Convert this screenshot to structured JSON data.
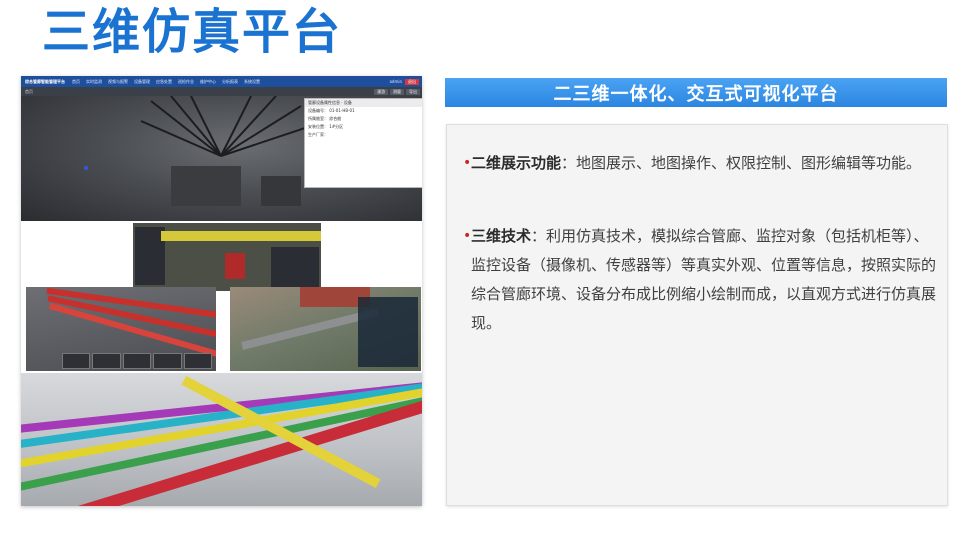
{
  "slide": {
    "title": "三维仿真平台"
  },
  "screenshot": {
    "app_title": "综合管廊智能管理平台",
    "nav_items": [
      "首页",
      "实时监测",
      "视频与报警",
      "设备管理",
      "应急处置",
      "巡检作业",
      "维护中心",
      "分析报表",
      "系统设置"
    ],
    "user": "admin",
    "exit_label": "退出",
    "breadcrumb": "首页",
    "tools": [
      "漫游",
      "测量",
      "导出"
    ],
    "popup": {
      "header": "管廊设备属性信息 · 设备",
      "rows": [
        "设备编号：  01-01-HB-01",
        "所属舱室：  综合舱",
        "安装位置：  1#分区",
        "生产厂家："
      ]
    }
  },
  "panel": {
    "banner": "二三维一体化、交互式可视化平台",
    "bullets": [
      {
        "term": "二维展示功能",
        "sep": "：",
        "text": "地图展示、地图操作、权限控制、图形编辑等功能。"
      },
      {
        "term": "三维技术",
        "sep": "：",
        "text": "利用仿真技术，模拟综合管廊、监控对象（包括机柜等）、监控设备（摄像机、传感器等）等真实外观、位置等信息，按照实际的综合管廊环境、设备分布成比例缩小绘制而成，以直观方式进行仿真展现。"
      }
    ]
  },
  "colors": {
    "title": "#1a73d1",
    "banner": "#2b86e0",
    "bullet_dot": "#c8282a"
  }
}
